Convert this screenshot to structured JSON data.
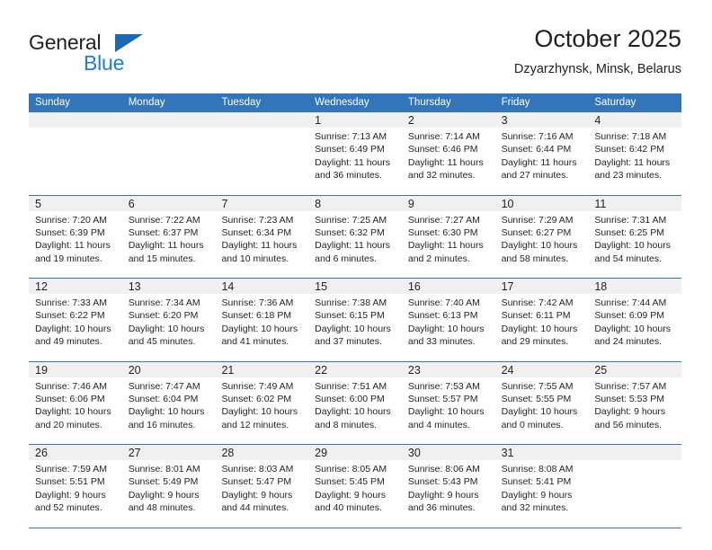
{
  "brand": {
    "name_part1": "General",
    "name_part2": "Blue",
    "triangle_color": "#1b68b3",
    "blue_color": "#1b7fd4"
  },
  "header": {
    "title": "October 2025",
    "subtitle": "Dzyarzhynsk, Minsk, Belarus"
  },
  "theme": {
    "header_blue": "#3275b8",
    "daynum_band": "#f0f0f0",
    "text": "#231f20"
  },
  "calendar": {
    "weekdays": [
      "Sunday",
      "Monday",
      "Tuesday",
      "Wednesday",
      "Thursday",
      "Friday",
      "Saturday"
    ],
    "weeks": [
      [
        {
          "day": ""
        },
        {
          "day": ""
        },
        {
          "day": ""
        },
        {
          "day": "1",
          "sunrise": "Sunrise: 7:13 AM",
          "sunset": "Sunset: 6:49 PM",
          "daylight_line1": "Daylight: 11 hours",
          "daylight_line2": "and 36 minutes."
        },
        {
          "day": "2",
          "sunrise": "Sunrise: 7:14 AM",
          "sunset": "Sunset: 6:46 PM",
          "daylight_line1": "Daylight: 11 hours",
          "daylight_line2": "and 32 minutes."
        },
        {
          "day": "3",
          "sunrise": "Sunrise: 7:16 AM",
          "sunset": "Sunset: 6:44 PM",
          "daylight_line1": "Daylight: 11 hours",
          "daylight_line2": "and 27 minutes."
        },
        {
          "day": "4",
          "sunrise": "Sunrise: 7:18 AM",
          "sunset": "Sunset: 6:42 PM",
          "daylight_line1": "Daylight: 11 hours",
          "daylight_line2": "and 23 minutes."
        }
      ],
      [
        {
          "day": "5",
          "sunrise": "Sunrise: 7:20 AM",
          "sunset": "Sunset: 6:39 PM",
          "daylight_line1": "Daylight: 11 hours",
          "daylight_line2": "and 19 minutes."
        },
        {
          "day": "6",
          "sunrise": "Sunrise: 7:22 AM",
          "sunset": "Sunset: 6:37 PM",
          "daylight_line1": "Daylight: 11 hours",
          "daylight_line2": "and 15 minutes."
        },
        {
          "day": "7",
          "sunrise": "Sunrise: 7:23 AM",
          "sunset": "Sunset: 6:34 PM",
          "daylight_line1": "Daylight: 11 hours",
          "daylight_line2": "and 10 minutes."
        },
        {
          "day": "8",
          "sunrise": "Sunrise: 7:25 AM",
          "sunset": "Sunset: 6:32 PM",
          "daylight_line1": "Daylight: 11 hours",
          "daylight_line2": "and 6 minutes."
        },
        {
          "day": "9",
          "sunrise": "Sunrise: 7:27 AM",
          "sunset": "Sunset: 6:30 PM",
          "daylight_line1": "Daylight: 11 hours",
          "daylight_line2": "and 2 minutes."
        },
        {
          "day": "10",
          "sunrise": "Sunrise: 7:29 AM",
          "sunset": "Sunset: 6:27 PM",
          "daylight_line1": "Daylight: 10 hours",
          "daylight_line2": "and 58 minutes."
        },
        {
          "day": "11",
          "sunrise": "Sunrise: 7:31 AM",
          "sunset": "Sunset: 6:25 PM",
          "daylight_line1": "Daylight: 10 hours",
          "daylight_line2": "and 54 minutes."
        }
      ],
      [
        {
          "day": "12",
          "sunrise": "Sunrise: 7:33 AM",
          "sunset": "Sunset: 6:22 PM",
          "daylight_line1": "Daylight: 10 hours",
          "daylight_line2": "and 49 minutes."
        },
        {
          "day": "13",
          "sunrise": "Sunrise: 7:34 AM",
          "sunset": "Sunset: 6:20 PM",
          "daylight_line1": "Daylight: 10 hours",
          "daylight_line2": "and 45 minutes."
        },
        {
          "day": "14",
          "sunrise": "Sunrise: 7:36 AM",
          "sunset": "Sunset: 6:18 PM",
          "daylight_line1": "Daylight: 10 hours",
          "daylight_line2": "and 41 minutes."
        },
        {
          "day": "15",
          "sunrise": "Sunrise: 7:38 AM",
          "sunset": "Sunset: 6:15 PM",
          "daylight_line1": "Daylight: 10 hours",
          "daylight_line2": "and 37 minutes."
        },
        {
          "day": "16",
          "sunrise": "Sunrise: 7:40 AM",
          "sunset": "Sunset: 6:13 PM",
          "daylight_line1": "Daylight: 10 hours",
          "daylight_line2": "and 33 minutes."
        },
        {
          "day": "17",
          "sunrise": "Sunrise: 7:42 AM",
          "sunset": "Sunset: 6:11 PM",
          "daylight_line1": "Daylight: 10 hours",
          "daylight_line2": "and 29 minutes."
        },
        {
          "day": "18",
          "sunrise": "Sunrise: 7:44 AM",
          "sunset": "Sunset: 6:09 PM",
          "daylight_line1": "Daylight: 10 hours",
          "daylight_line2": "and 24 minutes."
        }
      ],
      [
        {
          "day": "19",
          "sunrise": "Sunrise: 7:46 AM",
          "sunset": "Sunset: 6:06 PM",
          "daylight_line1": "Daylight: 10 hours",
          "daylight_line2": "and 20 minutes."
        },
        {
          "day": "20",
          "sunrise": "Sunrise: 7:47 AM",
          "sunset": "Sunset: 6:04 PM",
          "daylight_line1": "Daylight: 10 hours",
          "daylight_line2": "and 16 minutes."
        },
        {
          "day": "21",
          "sunrise": "Sunrise: 7:49 AM",
          "sunset": "Sunset: 6:02 PM",
          "daylight_line1": "Daylight: 10 hours",
          "daylight_line2": "and 12 minutes."
        },
        {
          "day": "22",
          "sunrise": "Sunrise: 7:51 AM",
          "sunset": "Sunset: 6:00 PM",
          "daylight_line1": "Daylight: 10 hours",
          "daylight_line2": "and 8 minutes."
        },
        {
          "day": "23",
          "sunrise": "Sunrise: 7:53 AM",
          "sunset": "Sunset: 5:57 PM",
          "daylight_line1": "Daylight: 10 hours",
          "daylight_line2": "and 4 minutes."
        },
        {
          "day": "24",
          "sunrise": "Sunrise: 7:55 AM",
          "sunset": "Sunset: 5:55 PM",
          "daylight_line1": "Daylight: 10 hours",
          "daylight_line2": "and 0 minutes."
        },
        {
          "day": "25",
          "sunrise": "Sunrise: 7:57 AM",
          "sunset": "Sunset: 5:53 PM",
          "daylight_line1": "Daylight: 9 hours",
          "daylight_line2": "and 56 minutes."
        }
      ],
      [
        {
          "day": "26",
          "sunrise": "Sunrise: 7:59 AM",
          "sunset": "Sunset: 5:51 PM",
          "daylight_line1": "Daylight: 9 hours",
          "daylight_line2": "and 52 minutes."
        },
        {
          "day": "27",
          "sunrise": "Sunrise: 8:01 AM",
          "sunset": "Sunset: 5:49 PM",
          "daylight_line1": "Daylight: 9 hours",
          "daylight_line2": "and 48 minutes."
        },
        {
          "day": "28",
          "sunrise": "Sunrise: 8:03 AM",
          "sunset": "Sunset: 5:47 PM",
          "daylight_line1": "Daylight: 9 hours",
          "daylight_line2": "and 44 minutes."
        },
        {
          "day": "29",
          "sunrise": "Sunrise: 8:05 AM",
          "sunset": "Sunset: 5:45 PM",
          "daylight_line1": "Daylight: 9 hours",
          "daylight_line2": "and 40 minutes."
        },
        {
          "day": "30",
          "sunrise": "Sunrise: 8:06 AM",
          "sunset": "Sunset: 5:43 PM",
          "daylight_line1": "Daylight: 9 hours",
          "daylight_line2": "and 36 minutes."
        },
        {
          "day": "31",
          "sunrise": "Sunrise: 8:08 AM",
          "sunset": "Sunset: 5:41 PM",
          "daylight_line1": "Daylight: 9 hours",
          "daylight_line2": "and 32 minutes."
        },
        {
          "day": ""
        }
      ]
    ]
  }
}
